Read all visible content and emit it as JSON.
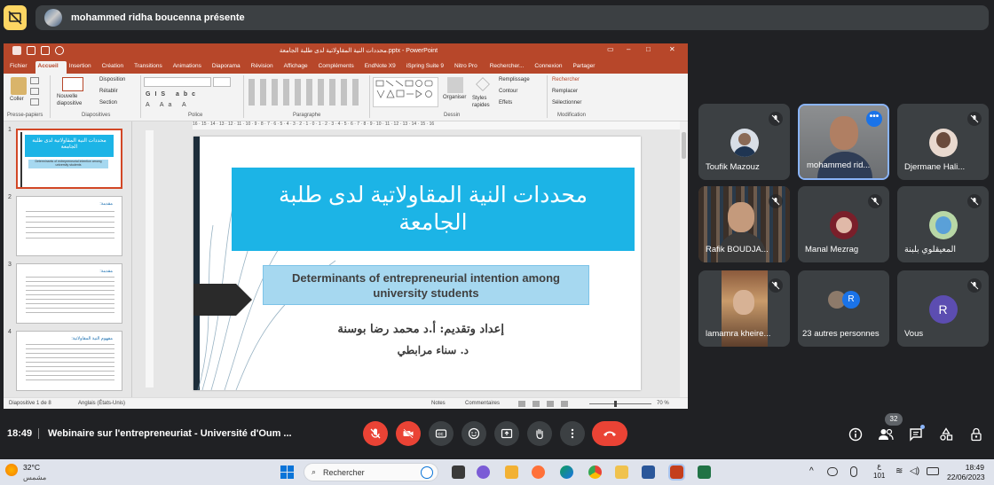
{
  "presenter": {
    "name": "mohammed ridha boucenna présente"
  },
  "ppt": {
    "window_title": "محددات النية المقاولاتية لدى طلبة الجامعة.pptx - PowerPoint",
    "tabs": [
      "Fichier",
      "Accueil",
      "Insertion",
      "Création",
      "Transitions",
      "Animations",
      "Diaporama",
      "Révision",
      "Affichage",
      "Compléments",
      "EndNote X9",
      "iSpring Suite 9",
      "Nitro Pro",
      "Rechercher...",
      "Connexion",
      "Partager"
    ],
    "active_tab": "Accueil",
    "ribbon": {
      "coller": "Coller",
      "presse_papiers": "Presse-papiers",
      "nouvelle_diapositive": "Nouvelle diapositive",
      "disposition": "Disposition",
      "retablir": "Rétablir",
      "section": "Section",
      "diapositives": "Diapositives",
      "police": "Police",
      "paragraphe": "Paragraphe",
      "dessin": "Dessin",
      "organiser": "Organiser",
      "styles_rapides": "Styles rapides",
      "remplissage": "Remplissage",
      "contour": "Contour",
      "effets": "Effets",
      "rechercher": "Rechercher",
      "remplacer": "Remplacer",
      "selectionner": "Sélectionner",
      "modification": "Modification"
    },
    "ruler": "16 · 15 · 14 · 13 · 12 · 11 · 10 · 9 · 8 · 7 · 6 · 5 · 4 · 3 · 2 · 1 · 0 · 1 · 2 · 3 · 4 · 5 · 6 · 7 · 8 · 9 · 10 · 11 · 12 · 13 · 14 · 15 · 16",
    "thumbnails": [
      {
        "num": "1",
        "title": "محددات النية المقاولاتية لدى طلبة الجامعة",
        "sub": "Determinants of entrepreneurial intention among university students"
      },
      {
        "num": "2",
        "title": "مقدمة:",
        "sub": ""
      },
      {
        "num": "3",
        "title": "مقدمة:",
        "sub": ""
      },
      {
        "num": "4",
        "title": "مفهوم النية المقاولاتية:",
        "sub": ""
      }
    ],
    "slide": {
      "title_ar": "محددات النية المقاولاتية لدى طلبة الجامعة",
      "subtitle_en": "Determinants of entrepreneurial intention among university students",
      "author1": "إعداد وتقديم: أ.د محمد رضا بوسنة",
      "author2": "د. سناء مرابطي"
    },
    "status": {
      "slide_count": "Diapositive 1 de 8",
      "language": "Anglais (États-Unis)",
      "notes": "Notes",
      "comments": "Commentaires",
      "zoom": "70 %"
    },
    "colors": {
      "ppt_accent": "#b7472a",
      "slide_blue": "#1cb4e6",
      "subtitle_box": "#a6d8f0"
    }
  },
  "participants": [
    {
      "name": "Toufik Mazouz",
      "muted": true,
      "avatar": "photo"
    },
    {
      "name": "mohammed rid...",
      "muted": false,
      "avatar": "video",
      "active": true
    },
    {
      "name": "Djermane Hali...",
      "muted": true,
      "avatar": "photo"
    },
    {
      "name": "Rafik BOUDJA...",
      "muted": true,
      "avatar": "video"
    },
    {
      "name": "Manal Mezrag",
      "muted": true,
      "avatar": "photo"
    },
    {
      "name": "المعيقلوي بلبنة",
      "muted": true,
      "avatar": "photo"
    },
    {
      "name": "lamamra kheire...",
      "muted": true,
      "avatar": "video"
    },
    {
      "name": "23 autres personnes",
      "muted": false,
      "avatar": "group",
      "letter": "R"
    },
    {
      "name": "Vous",
      "muted": true,
      "avatar": "letter",
      "letter": "R"
    }
  ],
  "meeting": {
    "time": "18:49",
    "title": "Webinaire sur l'entrepreneuriat - Université d'Oum ...",
    "participant_count": "32"
  },
  "taskbar": {
    "weather_temp": "32°C",
    "weather_label": "مشمس",
    "search_placeholder": "Rechercher",
    "lang_line1": "ع",
    "lang_line2": "101",
    "clock_time": "18:49",
    "clock_date": "22/06/2023"
  }
}
